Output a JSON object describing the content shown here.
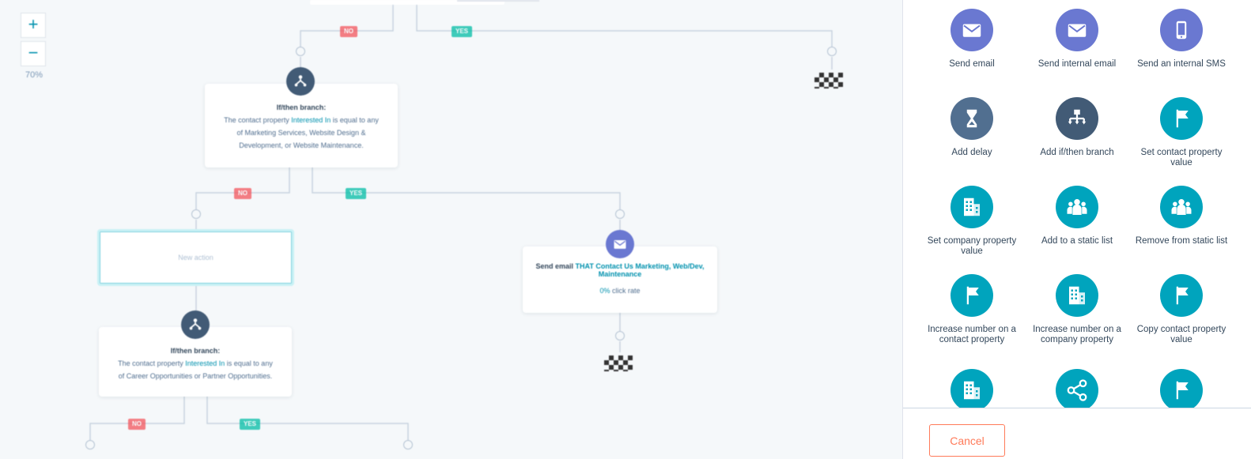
{
  "canvas": {
    "zoom": {
      "plus": "+",
      "minus": "−",
      "level": "70%"
    },
    "branch1": {
      "title": "If/then branch:",
      "line1_prefix": "The contact property",
      "property": "Interested In",
      "line1_suffix": "is equal to any",
      "line2": "of Marketing Services, Website Design &",
      "line3": "Development, or Website Maintenance."
    },
    "branch2": {
      "title": "If/then branch:",
      "line1_prefix": "The contact property",
      "property": "Interested In",
      "line1_suffix": "is equal to any",
      "line2": "of Career Opportunities or Partner Opportunities."
    },
    "new_action": "New action",
    "send_email": {
      "label": "Send email",
      "email_name": "THAT Contact Us Marketing, Web/Dev, Maintenance",
      "click_rate": "0%",
      "click_rate_label": "click rate"
    },
    "tags": {
      "no": "NO",
      "yes": "YES"
    }
  },
  "panel": {
    "actions": [
      {
        "label": "Send email",
        "icon": "envelope-icon",
        "color": "#6a78d1"
      },
      {
        "label": "Send internal email",
        "icon": "envelope-icon",
        "color": "#6a78d1"
      },
      {
        "label": "Send an internal SMS",
        "icon": "phone-icon",
        "color": "#6a78d1"
      },
      {
        "label": "Add delay",
        "icon": "hourglass-icon",
        "color": "#516f90"
      },
      {
        "label": "Add if/then branch",
        "icon": "branch-icon",
        "color": "#425b76"
      },
      {
        "label": "Set contact property value",
        "icon": "flag-icon",
        "color": "#00a4bd"
      },
      {
        "label": "Set company property value",
        "icon": "building-icon",
        "color": "#00a4bd"
      },
      {
        "label": "Add to a static list",
        "icon": "people-icon",
        "color": "#00a4bd"
      },
      {
        "label": "Remove from static list",
        "icon": "people-icon",
        "color": "#00a4bd"
      },
      {
        "label": "Increase number on a contact property",
        "icon": "flag-icon",
        "color": "#00a4bd"
      },
      {
        "label": "Increase number on a company property",
        "icon": "building-icon",
        "color": "#00a4bd"
      },
      {
        "label": "Copy contact property value",
        "icon": "flag-icon",
        "color": "#00a4bd"
      },
      {
        "label": "",
        "icon": "building-icon",
        "color": "#00a4bd"
      },
      {
        "label": "",
        "icon": "share-icon",
        "color": "#00a4bd"
      },
      {
        "label": "",
        "icon": "flag-icon",
        "color": "#00a4bd"
      }
    ],
    "cancel_label": "Cancel"
  }
}
